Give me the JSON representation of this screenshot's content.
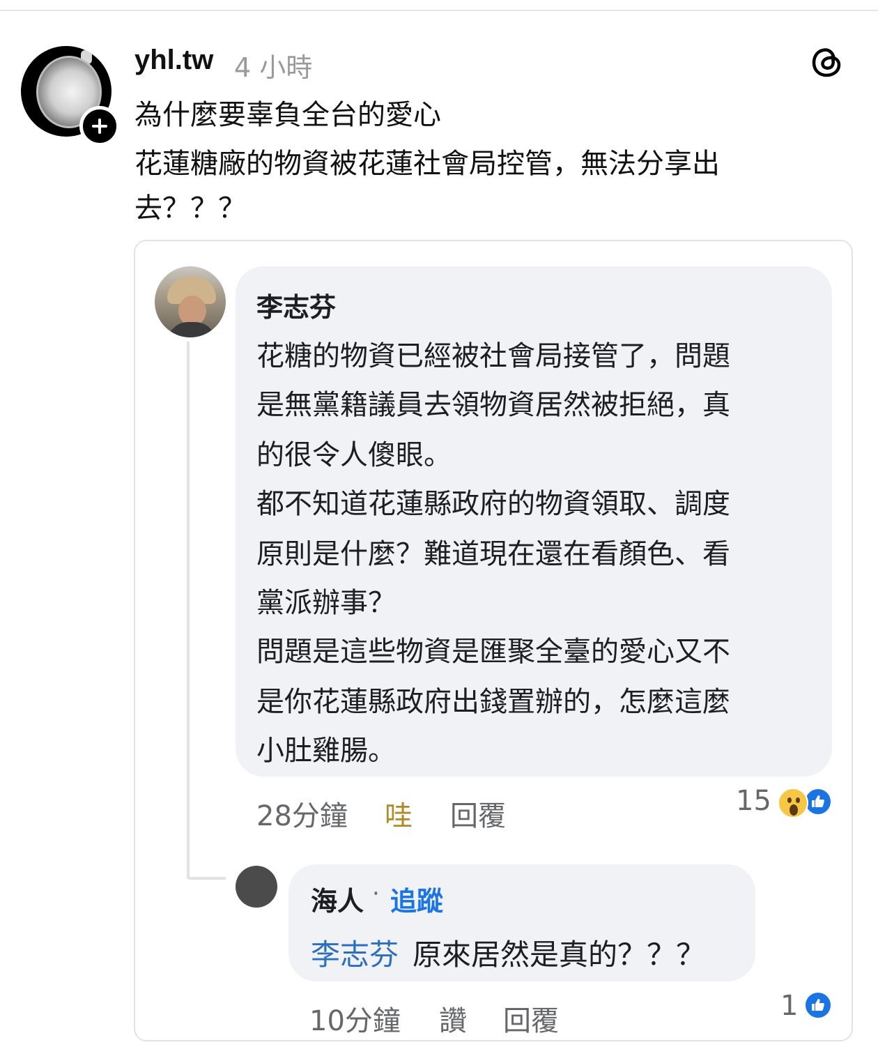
{
  "post": {
    "username": "yhl.tw",
    "time": "4 小時",
    "lines": [
      "為什麼要辜負全台的愛心",
      "花蓮糖廠的物資被花蓮社會局控管，無法分享出",
      "去？？？"
    ]
  },
  "comment1": {
    "author": "李志芬",
    "lines": [
      "花糖的物資已經被社會局接管了，問題",
      "是無黨籍議員去領物資居然被拒絕，真",
      "的很令人傻眼。",
      "都不知道花蓮縣政府的物資領取、調度",
      "原則是什麼？難道現在還在看顏色、看",
      "黨派辦事？",
      "問題是這些物資是匯聚全臺的愛心又不",
      "是你花蓮縣政府出錢置辦的，怎麼這麼",
      "小肚雞腸。"
    ],
    "time": "28分鐘",
    "reaction_label": "哇",
    "reply_label": "回覆",
    "reaction_count": "15"
  },
  "comment2": {
    "author": "海人",
    "separator": "·",
    "follow_label": "追蹤",
    "mention": "李志芬",
    "text": "原來居然是真的？？？",
    "time": "10分鐘",
    "like_label": "讚",
    "reply_label": "回覆",
    "reaction_count": "1"
  },
  "icons": {
    "threads": "threads-logo-icon",
    "follow_plus": "plus-icon",
    "wow": "wow-reaction-icon",
    "like": "like-reaction-icon"
  },
  "colors": {
    "accent_blue": "#1b74e4",
    "wow_gold": "#b08a26",
    "bubble_bg": "#f0f2f5"
  }
}
